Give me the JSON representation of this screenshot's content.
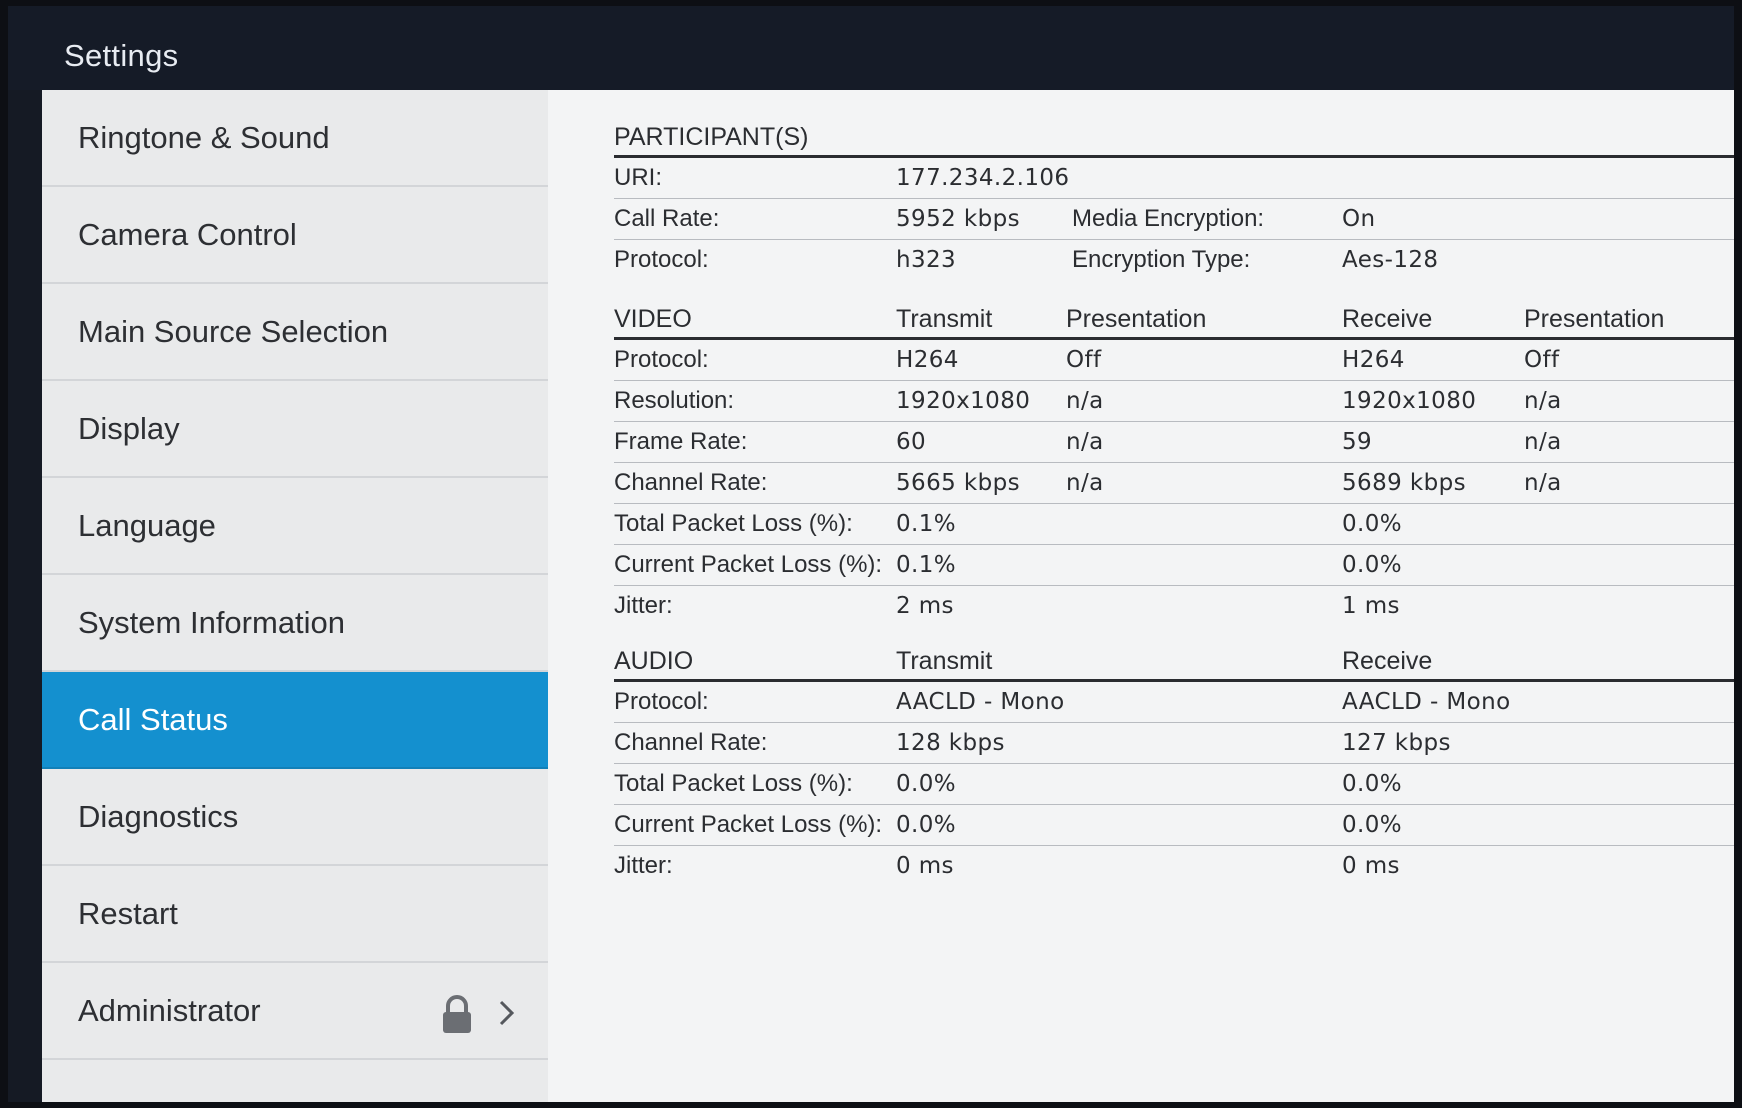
{
  "window": {
    "title": "Settings"
  },
  "sidebar": {
    "items": [
      {
        "label": "Ringtone & Sound"
      },
      {
        "label": "Camera Control"
      },
      {
        "label": "Main Source Selection"
      },
      {
        "label": "Display"
      },
      {
        "label": "Language"
      },
      {
        "label": "System Information"
      },
      {
        "label": "Call Status",
        "active": true
      },
      {
        "label": "Diagnostics"
      },
      {
        "label": "Restart"
      },
      {
        "label": "Administrator",
        "icons": [
          "lock-icon",
          "chevron-right-icon"
        ]
      }
    ]
  },
  "participants": {
    "heading": "PARTICIPANT(S)",
    "uri_label": "URI:",
    "uri_value": "177.234.2.106",
    "call_rate_label": "Call Rate:",
    "call_rate_value": "5952 kbps",
    "media_encryption_label": "Media Encryption:",
    "media_encryption_value": "On",
    "protocol_label": "Protocol:",
    "protocol_value": "h323",
    "encryption_type_label": "Encryption Type:",
    "encryption_type_value": "Aes-128"
  },
  "video": {
    "heading": "VIDEO",
    "columns": [
      "Transmit",
      "Presentation",
      "Receive",
      "Presentation"
    ],
    "rows": [
      {
        "label": "Protocol:",
        "tx": "H264",
        "tx_pres": "Off",
        "rx": "H264",
        "rx_pres": "Off"
      },
      {
        "label": "Resolution:",
        "tx": "1920x1080",
        "tx_pres": "n/a",
        "rx": "1920x1080",
        "rx_pres": "n/a"
      },
      {
        "label": "Frame Rate:",
        "tx": "60",
        "tx_pres": "n/a",
        "rx": "59",
        "rx_pres": "n/a"
      },
      {
        "label": "Channel Rate:",
        "tx": "5665 kbps",
        "tx_pres": "n/a",
        "rx": "5689 kbps",
        "rx_pres": "n/a"
      },
      {
        "label": "Total Packet Loss (%):",
        "tx": "0.1%",
        "tx_pres": "",
        "rx": "0.0%",
        "rx_pres": ""
      },
      {
        "label": "Current Packet Loss (%):",
        "tx": "0.1%",
        "tx_pres": "",
        "rx": "0.0%",
        "rx_pres": ""
      },
      {
        "label": "Jitter:",
        "tx": "2 ms",
        "tx_pres": "",
        "rx": "1 ms",
        "rx_pres": ""
      }
    ]
  },
  "audio": {
    "heading": "AUDIO",
    "columns": [
      "Transmit",
      "Receive"
    ],
    "rows": [
      {
        "label": "Protocol:",
        "tx": "AACLD - Mono",
        "rx": "AACLD - Mono"
      },
      {
        "label": "Channel Rate:",
        "tx": "128 kbps",
        "rx": "127 kbps"
      },
      {
        "label": "Total Packet Loss (%):",
        "tx": "0.0%",
        "rx": "0.0%"
      },
      {
        "label": "Current Packet Loss (%):",
        "tx": "0.0%",
        "rx": "0.0%"
      },
      {
        "label": "Jitter:",
        "tx": "0 ms",
        "rx": "0 ms"
      }
    ]
  },
  "colors": {
    "accent": "#1490cf",
    "titlebar": "#151b27",
    "sidebar_bg": "#e9eaeb",
    "content_bg": "#f3f4f5"
  }
}
